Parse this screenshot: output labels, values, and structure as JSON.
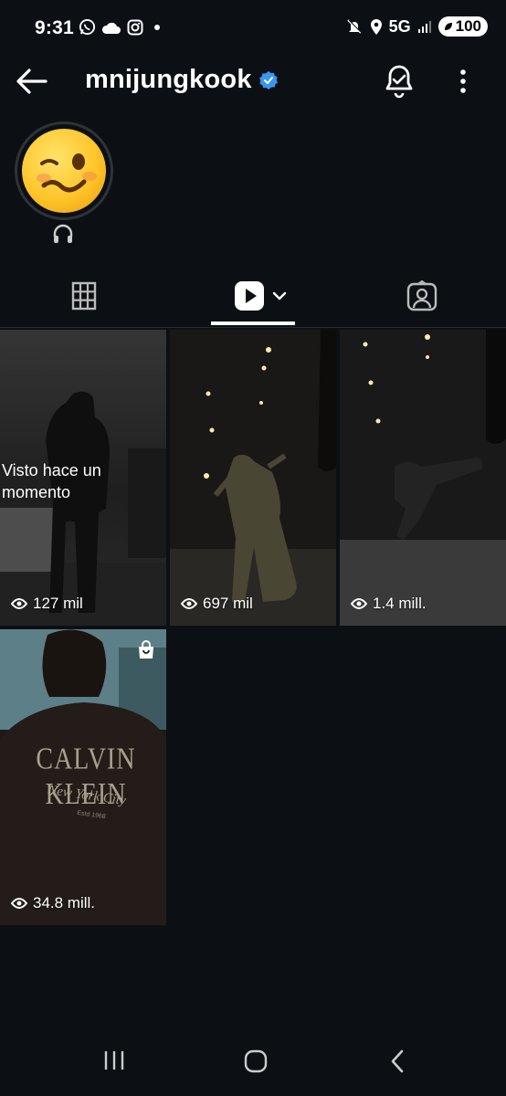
{
  "status": {
    "time": "9:31",
    "network": "5G",
    "battery": "100",
    "icons": [
      "whatsapp-icon",
      "cloud-icon",
      "instagram-icon",
      "dot-icon",
      "mute-icon",
      "location-icon",
      "signal-icon",
      "battery-icon"
    ]
  },
  "header": {
    "username": "mnijungkook",
    "verified": true,
    "icons": [
      "back-arrow-icon",
      "verified-badge-icon",
      "notification-bell-icon",
      "more-options-icon"
    ]
  },
  "profile": {
    "avatar_emoji": "woozy-face",
    "note_icon": "headphones-icon"
  },
  "tabs": [
    {
      "name": "posts",
      "icon": "grid-icon",
      "active": false
    },
    {
      "name": "reels",
      "icon": "reels-play-icon",
      "active": true
    },
    {
      "name": "tagged",
      "icon": "tagged-person-icon",
      "active": false
    }
  ],
  "reels": [
    {
      "views": "127 mil",
      "overlay_text": "Visto hace un momento"
    },
    {
      "views": "697 mil"
    },
    {
      "views": "1.4 mill."
    },
    {
      "views": "34.8 mill.",
      "shopping": true,
      "print": {
        "brand": "CALVIN KLEIN",
        "script": "New York City",
        "small": "Estd 1968"
      }
    }
  ],
  "nav": [
    "recent-apps-icon",
    "home-icon",
    "back-icon"
  ]
}
